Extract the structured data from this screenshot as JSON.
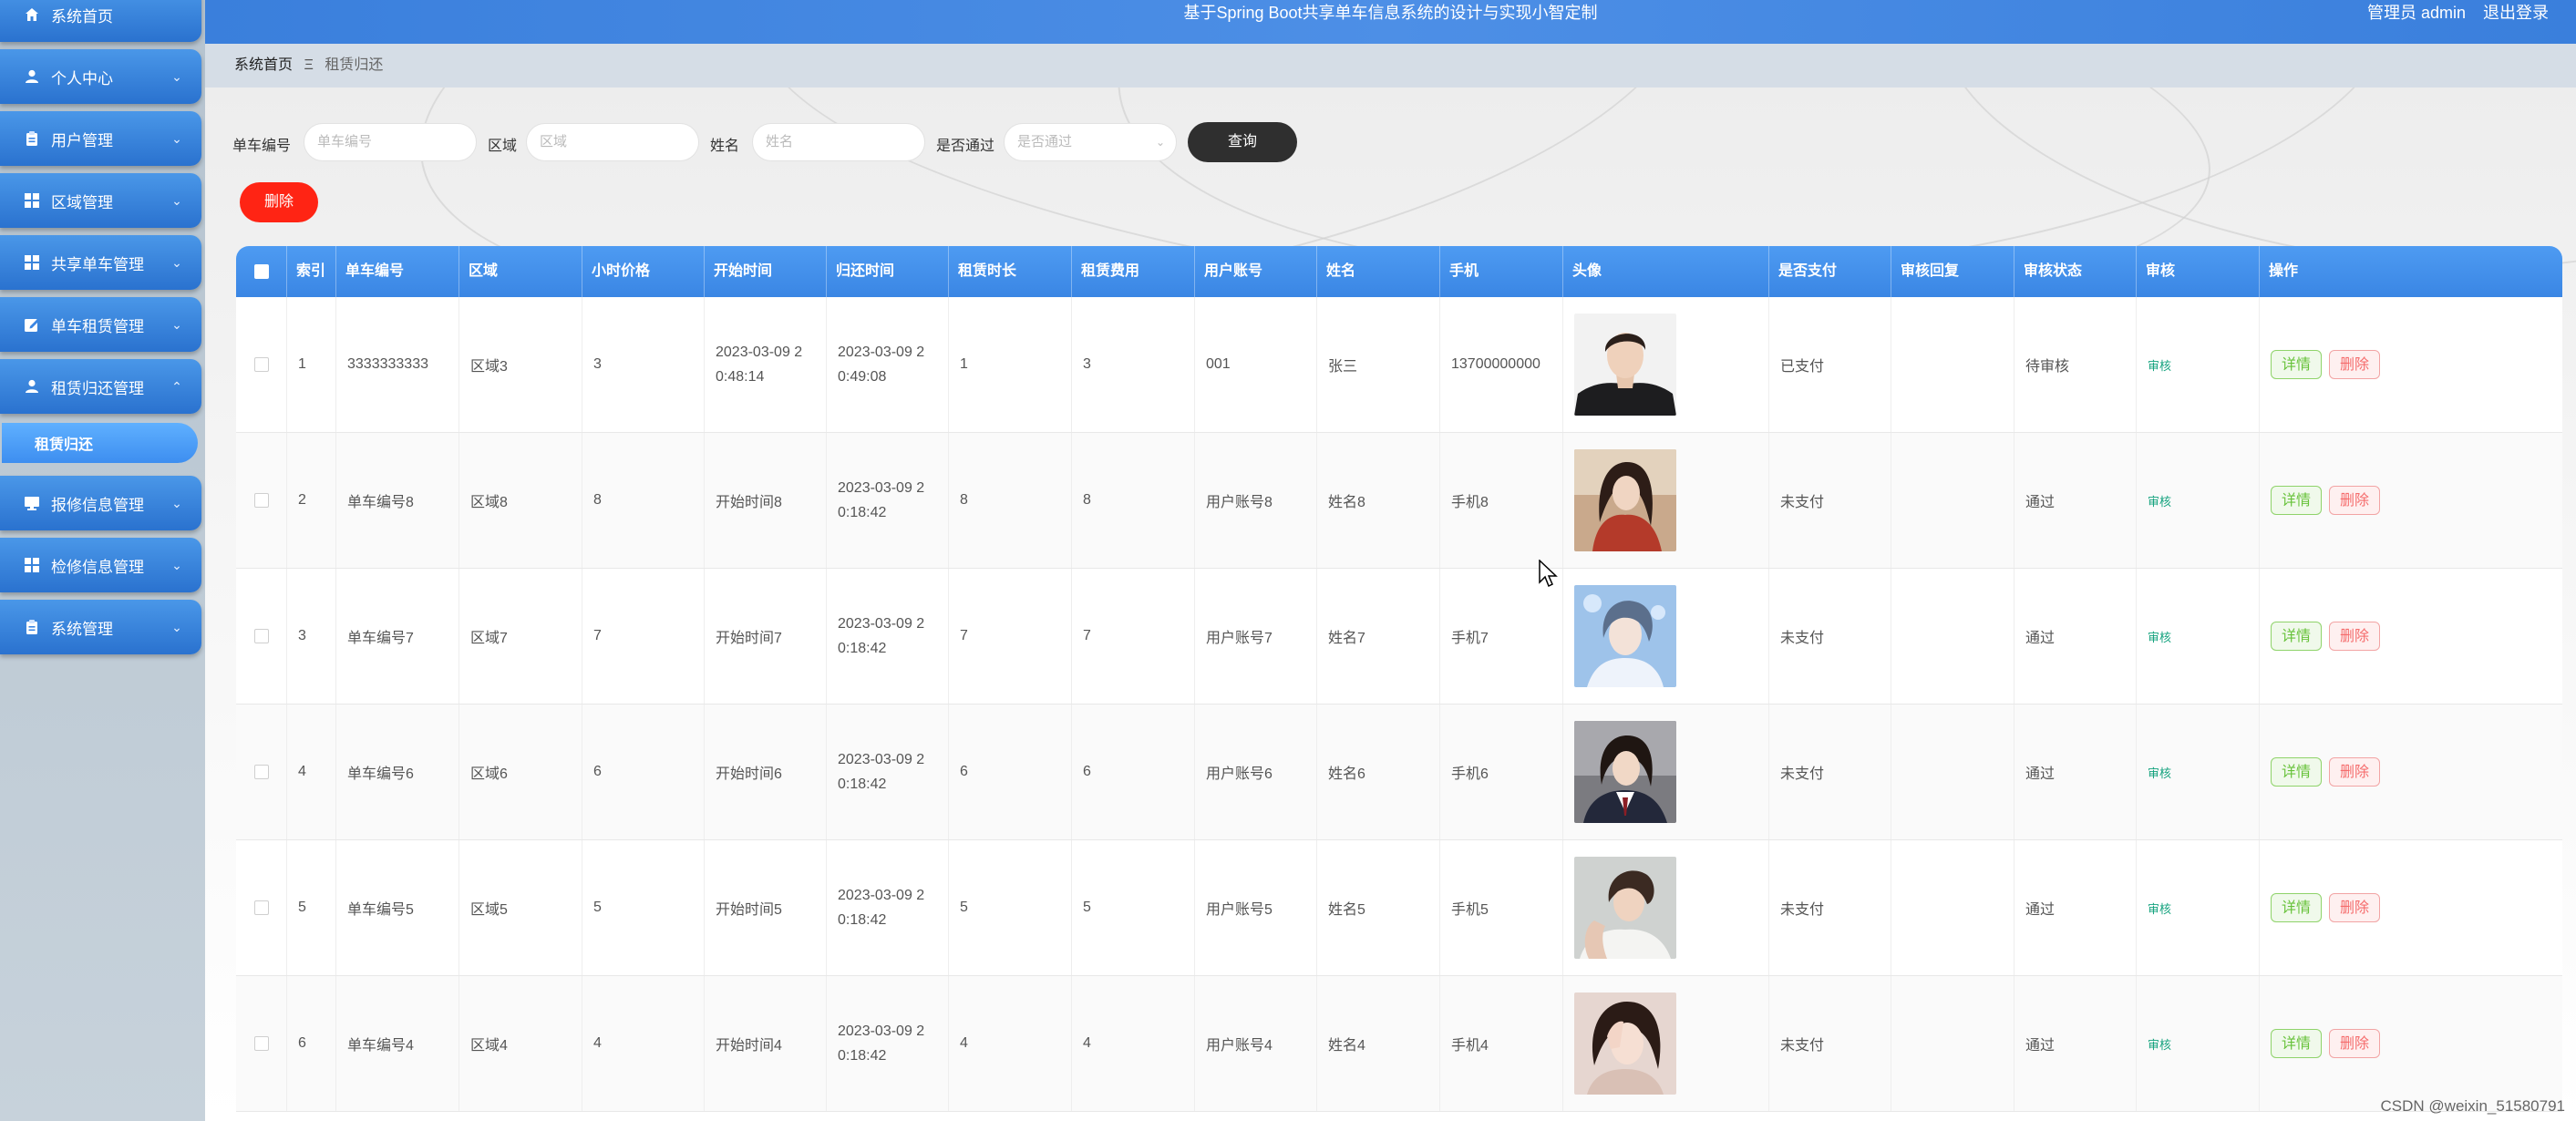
{
  "header": {
    "title": "基于Spring Boot共享单车信息系统的设计与实现小智定制",
    "user": "管理员 admin",
    "logout": "退出登录"
  },
  "breadcrumb": {
    "home": "系统首页",
    "separator": "Ξ",
    "current": "租赁归还"
  },
  "sidebar": {
    "items": [
      {
        "label": "系统首页",
        "icon": "home-icon",
        "chev": ""
      },
      {
        "label": "个人中心",
        "icon": "user-icon",
        "chev": "⌄"
      },
      {
        "label": "用户管理",
        "icon": "clipboard-icon",
        "chev": "⌄"
      },
      {
        "label": "区域管理",
        "icon": "grid-icon",
        "chev": "⌄"
      },
      {
        "label": "共享单车管理",
        "icon": "grid-icon",
        "chev": "⌄"
      },
      {
        "label": "单车租赁管理",
        "icon": "edit-icon",
        "chev": "⌄"
      },
      {
        "label": "租赁归还管理",
        "icon": "user-icon",
        "chev": "⌃"
      },
      {
        "label": "报修信息管理",
        "icon": "monitor-icon",
        "chev": "⌄"
      },
      {
        "label": "检修信息管理",
        "icon": "grid-icon",
        "chev": "⌄"
      },
      {
        "label": "系统管理",
        "icon": "clipboard-icon",
        "chev": "⌄"
      }
    ],
    "active_sub": "租赁归还"
  },
  "search": {
    "bike_no_label": "单车编号",
    "bike_no_placeholder": "单车编号",
    "area_label": "区域",
    "area_placeholder": "区域",
    "name_label": "姓名",
    "name_placeholder": "姓名",
    "passed_label": "是否通过",
    "passed_placeholder": "是否通过",
    "query_button": "查询"
  },
  "toolbar": {
    "delete_button": "删除"
  },
  "table": {
    "columns": [
      "索引",
      "单车编号",
      "区域",
      "小时价格",
      "开始时间",
      "归还时间",
      "租赁时长",
      "租赁费用",
      "用户账号",
      "姓名",
      "手机",
      "头像",
      "是否支付",
      "审核回复",
      "审核状态",
      "审核",
      "操作"
    ],
    "rows": [
      {
        "idx": "1",
        "bike": "3333333333",
        "area": "区域3",
        "price": "3",
        "start": "2023-03-09 2\n0:48:14",
        "end": "2023-03-09 2\n0:49:08",
        "dur": "1",
        "fee": "3",
        "account": "001",
        "name": "张三",
        "phone": "13700000000",
        "paid": "已支付",
        "reply": "",
        "status": "待审核",
        "audit": "审核",
        "detail": "详情",
        "del": "删除"
      },
      {
        "idx": "2",
        "bike": "单车编号8",
        "area": "区域8",
        "price": "8",
        "start": "开始时间8",
        "end": "2023-03-09 2\n0:18:42",
        "dur": "8",
        "fee": "8",
        "account": "用户账号8",
        "name": "姓名8",
        "phone": "手机8",
        "paid": "未支付",
        "reply": "",
        "status": "通过",
        "audit": "审核",
        "detail": "详情",
        "del": "删除"
      },
      {
        "idx": "3",
        "bike": "单车编号7",
        "area": "区域7",
        "price": "7",
        "start": "开始时间7",
        "end": "2023-03-09 2\n0:18:42",
        "dur": "7",
        "fee": "7",
        "account": "用户账号7",
        "name": "姓名7",
        "phone": "手机7",
        "paid": "未支付",
        "reply": "",
        "status": "通过",
        "audit": "审核",
        "detail": "详情",
        "del": "删除"
      },
      {
        "idx": "4",
        "bike": "单车编号6",
        "area": "区域6",
        "price": "6",
        "start": "开始时间6",
        "end": "2023-03-09 2\n0:18:42",
        "dur": "6",
        "fee": "6",
        "account": "用户账号6",
        "name": "姓名6",
        "phone": "手机6",
        "paid": "未支付",
        "reply": "",
        "status": "通过",
        "audit": "审核",
        "detail": "详情",
        "del": "删除"
      },
      {
        "idx": "5",
        "bike": "单车编号5",
        "area": "区域5",
        "price": "5",
        "start": "开始时间5",
        "end": "2023-03-09 2\n0:18:42",
        "dur": "5",
        "fee": "5",
        "account": "用户账号5",
        "name": "姓名5",
        "phone": "手机5",
        "paid": "未支付",
        "reply": "",
        "status": "通过",
        "audit": "审核",
        "detail": "详情",
        "del": "删除"
      },
      {
        "idx": "6",
        "bike": "单车编号4",
        "area": "区域4",
        "price": "4",
        "start": "开始时间4",
        "end": "2023-03-09 2\n0:18:42",
        "dur": "4",
        "fee": "4",
        "account": "用户账号4",
        "name": "姓名4",
        "phone": "手机4",
        "paid": "未支付",
        "reply": "",
        "status": "通过",
        "audit": "审核",
        "detail": "详情",
        "del": "删除"
      }
    ]
  },
  "watermark": "CSDN @weixin_51580791"
}
